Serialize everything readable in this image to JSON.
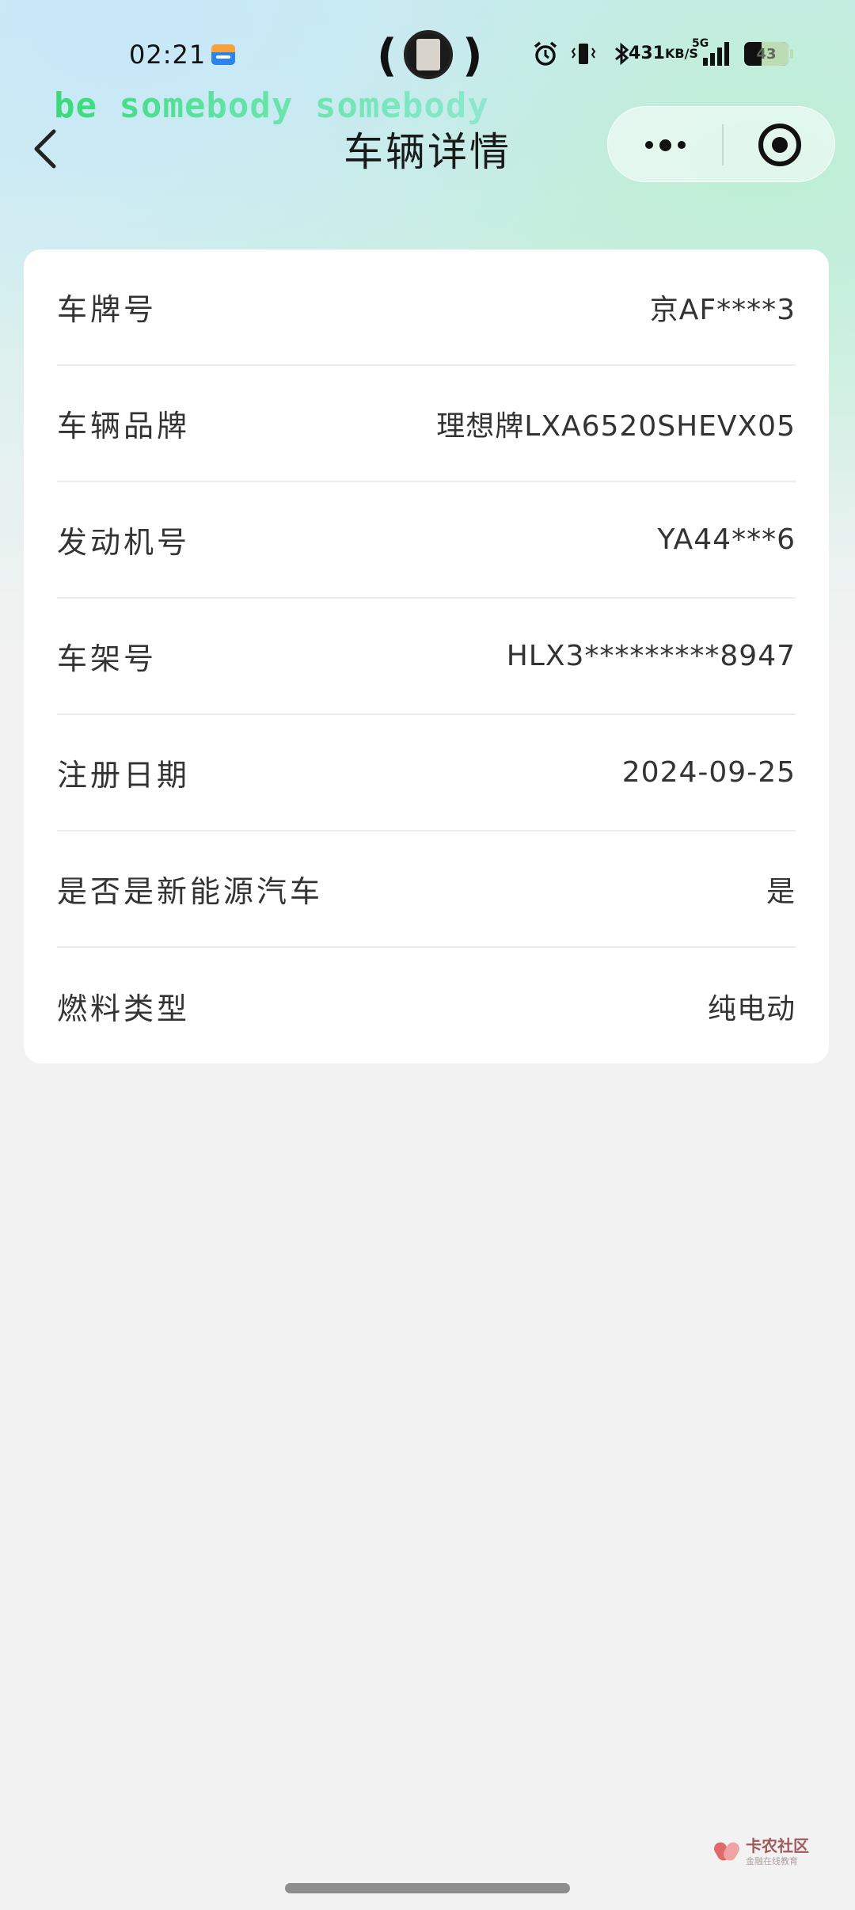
{
  "status_bar": {
    "time": "02:21",
    "network_speed_value": "431",
    "network_speed_unit": "KB/S",
    "network_type": "5G",
    "battery_level": "43"
  },
  "overlay": {
    "text": "be somebody somebody"
  },
  "nav": {
    "title": "车辆详情"
  },
  "vehicle": {
    "rows": [
      {
        "label": "车牌号",
        "value": "京AF****3"
      },
      {
        "label": "车辆品牌",
        "value": "理想牌LXA6520SHEVX05"
      },
      {
        "label": "发动机号",
        "value": "YA44***6"
      },
      {
        "label": "车架号",
        "value": "HLX3*********8947"
      },
      {
        "label": "注册日期",
        "value": "2024-09-25"
      },
      {
        "label": "是否是新能源汽车",
        "value": "是"
      },
      {
        "label": "燃料类型",
        "value": "纯电动"
      }
    ]
  },
  "watermark": {
    "main": "卡农社区",
    "sub": "金融在线教育"
  },
  "colors": {
    "page_bg": "#f2f2f2",
    "card_bg": "#ffffff",
    "text": "#333333",
    "overlay_green": "#3ad97a"
  }
}
